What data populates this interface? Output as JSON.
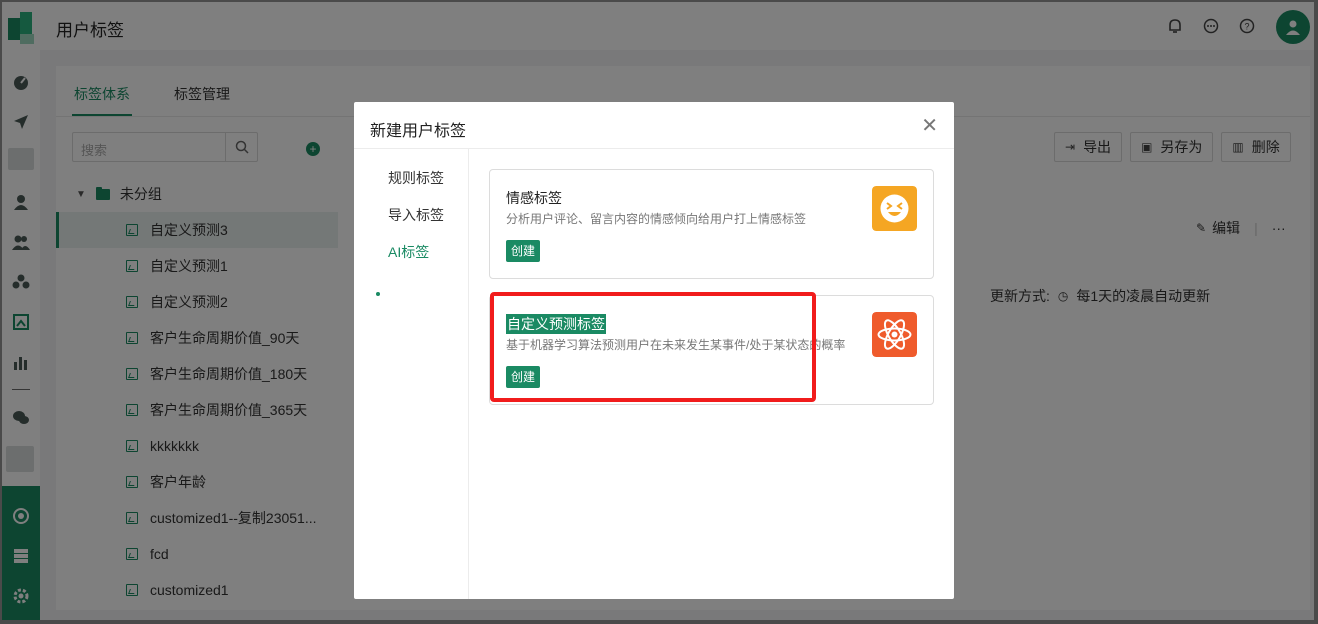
{
  "header": {
    "title": "用户标签"
  },
  "tabs": [
    {
      "label": "标签体系"
    },
    {
      "label": "标签管理"
    }
  ],
  "search": {
    "placeholder": "搜索"
  },
  "group": {
    "label": "未分组"
  },
  "tree_items": [
    "自定义预测3",
    "自定义预测1",
    "自定义预测2",
    "客户生命周期价值_90天",
    "客户生命周期价值_180天",
    "客户生命周期价值_365天",
    "kkkkkkk",
    "客户年龄",
    "customized1--复制23051...",
    "fcd",
    "customized1"
  ],
  "toolbar": {
    "export_label": "导出",
    "save_as_label": "另存为",
    "delete_label": "删除"
  },
  "detail": {
    "edit_label": "编辑",
    "more_label": "···",
    "update_label": "更新方式:",
    "update_value": "每1天的凌晨自动更新"
  },
  "modal": {
    "title": "新建用户标签",
    "side_items": [
      "规则标签",
      "导入标签",
      "AI标签"
    ],
    "cards": [
      {
        "title": "情感标签",
        "desc": "分析用户评论、留言内容的情感倾向给用户打上情感标签",
        "button": "创建",
        "icon": "smiley-face-icon",
        "icon_color": "#f5a623"
      },
      {
        "title": "自定义预测标签",
        "desc": "基于机器学习算法预测用户在未来发生某事件/处于某状态的概率",
        "button": "创建",
        "icon": "atom-icon",
        "icon_color": "#ef5b2c"
      }
    ]
  },
  "colors": {
    "accent": "#1a8a63",
    "highlight_box": "#f11c1c"
  }
}
